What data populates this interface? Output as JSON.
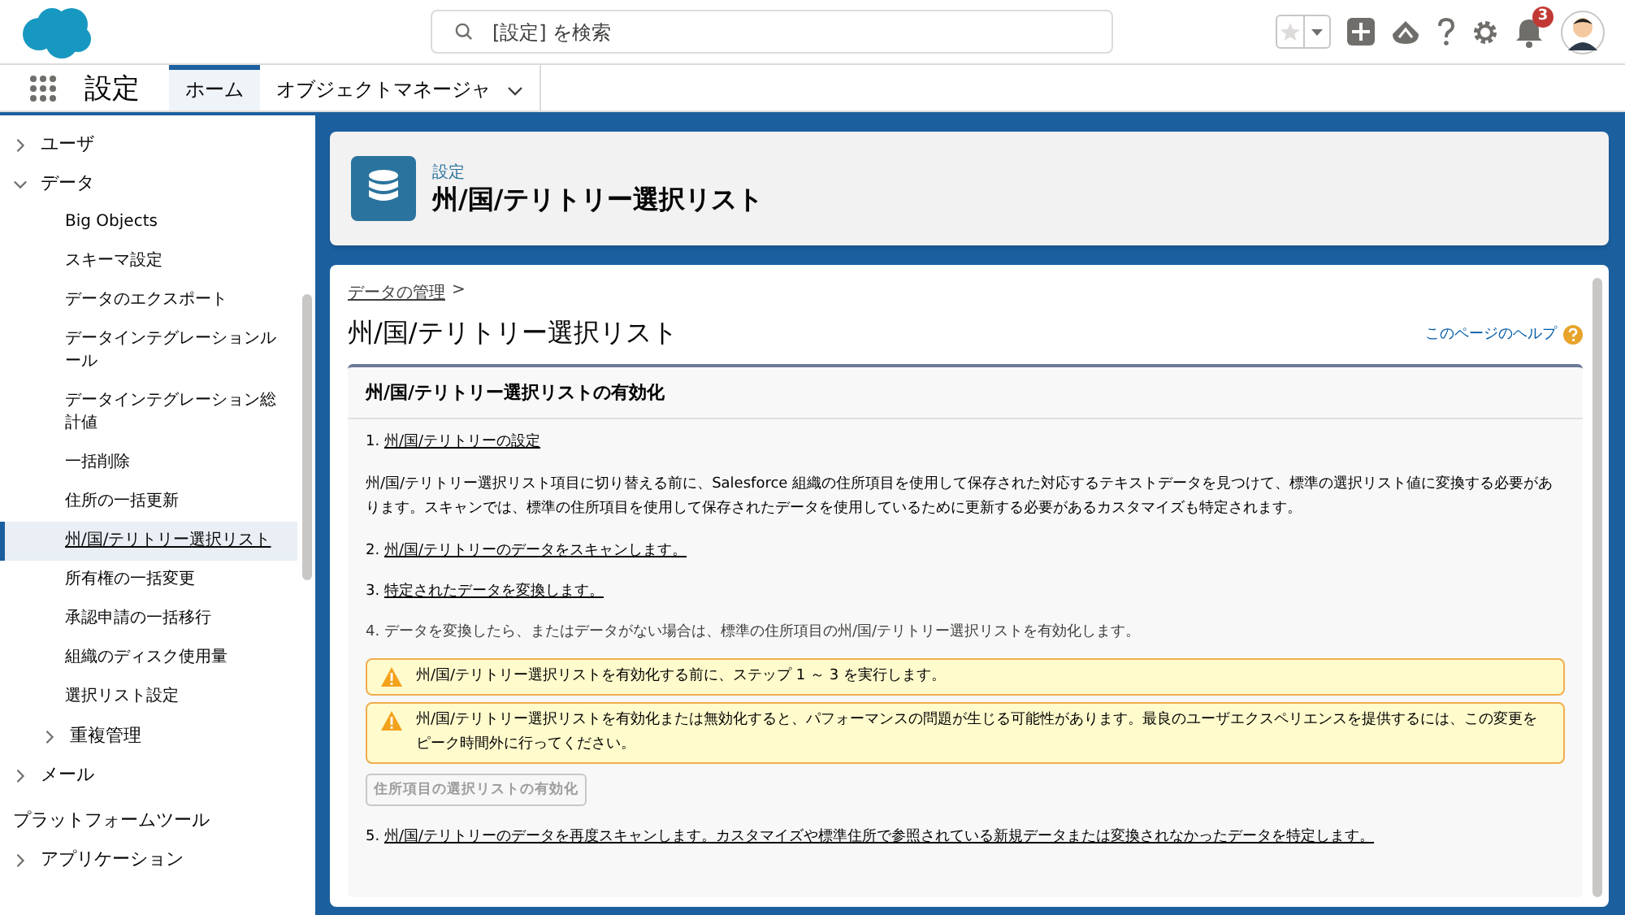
{
  "header": {
    "search": {
      "placeholder": "[設定] を検索"
    },
    "notification_count": "3"
  },
  "app_nav": {
    "title": "設定",
    "tabs": [
      {
        "label": "ホーム",
        "selected": true
      },
      {
        "label": "オブジェクトマネージャ",
        "selected": false
      }
    ]
  },
  "sidebar": {
    "items": [
      {
        "kind": "group",
        "label": "ユーザ",
        "expanded": false
      },
      {
        "kind": "group",
        "label": "データ",
        "expanded": true,
        "children": [
          {
            "kind": "link",
            "label": "Big Objects",
            "selected": false
          },
          {
            "kind": "link",
            "label": "スキーマ設定",
            "selected": false
          },
          {
            "kind": "link",
            "label": "データのエクスポート",
            "selected": false
          },
          {
            "kind": "link",
            "label": "データインテグレーションルール",
            "selected": false
          },
          {
            "kind": "link",
            "label": "データインテグレーション総計値",
            "selected": false
          },
          {
            "kind": "link",
            "label": "一括削除",
            "selected": false
          },
          {
            "kind": "link",
            "label": "住所の一括更新",
            "selected": false
          },
          {
            "kind": "link",
            "label": "州/国/テリトリー選択リスト",
            "selected": true
          },
          {
            "kind": "link",
            "label": "所有権の一括変更",
            "selected": false
          },
          {
            "kind": "link",
            "label": "承認申請の一括移行",
            "selected": false
          },
          {
            "kind": "link",
            "label": "組織のディスク使用量",
            "selected": false
          },
          {
            "kind": "link",
            "label": "選択リスト設定",
            "selected": false
          },
          {
            "kind": "group",
            "label": "重複管理",
            "expanded": false
          }
        ]
      },
      {
        "kind": "group",
        "label": "メール",
        "expanded": false
      },
      {
        "kind": "heading",
        "label": "プラットフォームツール"
      },
      {
        "kind": "group",
        "label": "アプリケーション",
        "expanded": false
      }
    ]
  },
  "page_header": {
    "eyebrow": "設定",
    "title": "州/国/テリトリー選択リスト"
  },
  "content": {
    "breadcrumb": "データの管理",
    "breadcrumb_separator": ">",
    "title": "州/国/テリトリー選択リスト",
    "help_link": "このページのヘルプ",
    "section_title": "州/国/テリトリー選択リストの有効化",
    "blocks": [
      {
        "kind": "step",
        "number": "1.",
        "text": "州/国/テリトリーの設定",
        "linked": true
      },
      {
        "kind": "paragraph",
        "text": "州/国/テリトリー選択リスト項目に切り替える前に、Salesforce 組織の住所項目を使用して保存された対応するテキストデータを見つけて、標準の選択リスト値に変換する必要があります。スキャンでは、標準の住所項目を使用して保存されたデータを使用しているために更新する必要があるカスタマイズも特定されます。"
      },
      {
        "kind": "step",
        "number": "2.",
        "text": "州/国/テリトリーのデータをスキャンします。",
        "linked": true
      },
      {
        "kind": "step",
        "number": "3.",
        "text": "特定されたデータを変換します。",
        "linked": true
      },
      {
        "kind": "step",
        "number": "4.",
        "text": "データを変換したら、またはデータがない場合は、標準の住所項目の州/国/テリトリー選択リストを有効化します。",
        "linked": false
      },
      {
        "kind": "warning",
        "text": "州/国/テリトリー選択リストを有効化する前に、ステップ 1 ～ 3 を実行します。"
      },
      {
        "kind": "warning",
        "text": "州/国/テリトリー選択リストを有効化または無効化すると、パフォーマンスの問題が生じる可能性があります。最良のユーザエクスペリエンスを提供するには、この変更をピーク時間外に行ってください。"
      },
      {
        "kind": "button",
        "text": "住所項目の選択リストの有効化",
        "disabled": true
      },
      {
        "kind": "step",
        "number": "5.",
        "text": "州/国/テリトリーのデータを再度スキャンします。カスタマイズや標準住所で参照されている新規データまたは変換されなかったデータを特定します。",
        "linked": true
      }
    ]
  }
}
